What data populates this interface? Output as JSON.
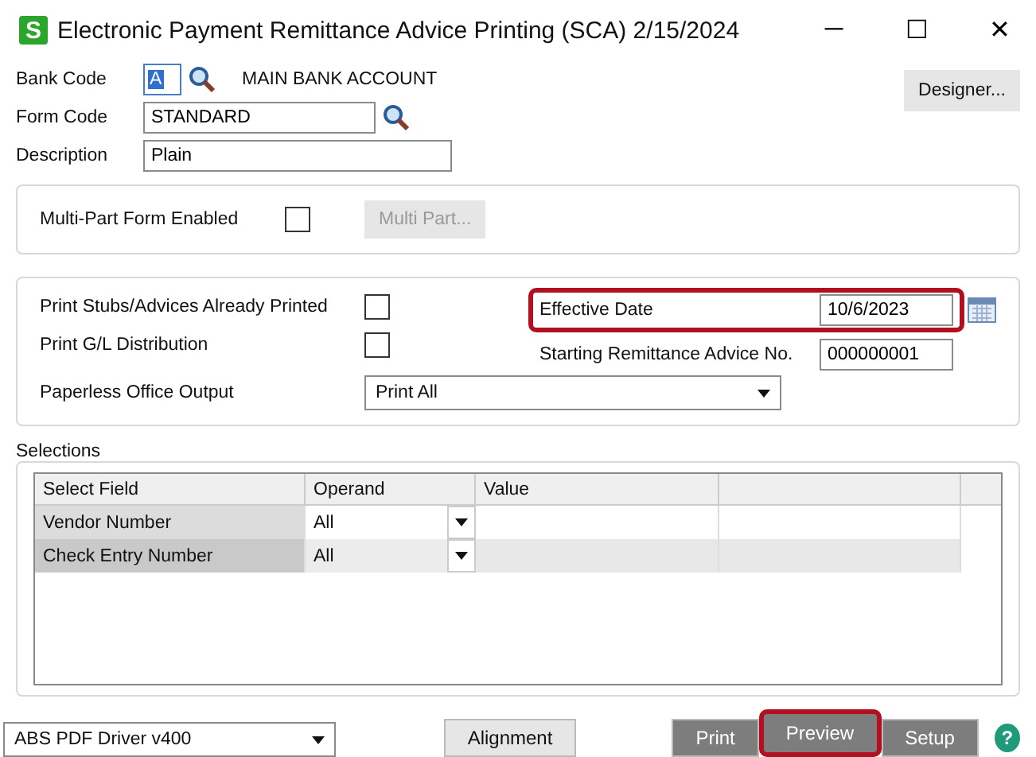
{
  "window": {
    "app_icon": "S",
    "title": "Electronic Payment Remittance Advice Printing (SCA) 2/15/2024",
    "controls": [
      "─",
      "☐",
      "✕"
    ]
  },
  "header": {
    "bank_code": {
      "label": "Bank Code",
      "value": "A",
      "name": "MAIN BANK ACCOUNT"
    },
    "form_code": {
      "label": "Form Code",
      "value": "STANDARD"
    },
    "description": {
      "label": "Description",
      "value": "Plain"
    },
    "designer_button": "Designer..."
  },
  "multipart": {
    "label": "Multi-Part Form Enabled",
    "checked": false,
    "button": "Multi Part...",
    "button_disabled": true
  },
  "options": {
    "print_stubs": {
      "label": "Print Stubs/Advices Already Printed",
      "checked": false
    },
    "print_gl": {
      "label": "Print G/L Distribution",
      "checked": false
    },
    "paperless": {
      "label": "Paperless Office Output",
      "value": "Print All"
    },
    "effective_date": {
      "label": "Effective Date",
      "value": "10/6/2023",
      "highlighted": true
    },
    "starting_no": {
      "label": "Starting Remittance Advice No.",
      "value": "000000001"
    }
  },
  "selections": {
    "title": "Selections",
    "columns": [
      "Select Field",
      "Operand",
      "Value"
    ],
    "rows": [
      {
        "field": "Vendor Number",
        "operand": "All",
        "selected": false
      },
      {
        "field": "Check Entry Number",
        "operand": "All",
        "selected": true
      }
    ]
  },
  "footer": {
    "printer": "ABS PDF Driver v400",
    "buttons": [
      {
        "label": "Alignment",
        "kind": "light",
        "highlighted": false
      },
      {
        "label": "Print",
        "kind": "dark",
        "highlighted": false
      },
      {
        "label": "Preview",
        "kind": "dark",
        "highlighted": true
      },
      {
        "label": "Setup",
        "kind": "dark",
        "highlighted": false
      }
    ],
    "help": "?"
  }
}
